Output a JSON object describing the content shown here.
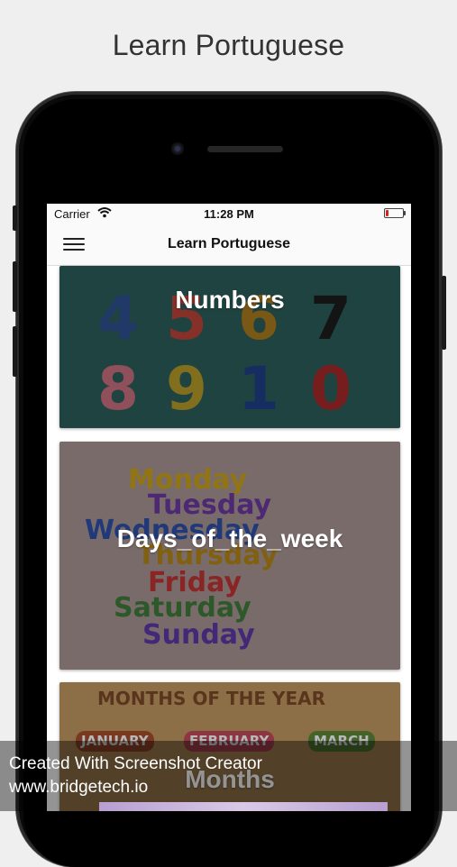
{
  "headline": "Learn Portuguese",
  "status_bar": {
    "carrier": "Carrier",
    "time": "11:28 PM"
  },
  "app_bar": {
    "title": "Learn Portuguese",
    "menu_icon": "hamburger-menu-icon"
  },
  "categories": [
    {
      "label": "Numbers",
      "art_text": [
        "4",
        "5",
        "6",
        "7",
        "8",
        "9",
        "1",
        "0"
      ]
    },
    {
      "label": "Days_of_the_week",
      "art_text": [
        "Monday",
        "Tuesday",
        "Wednesday",
        "Thursday",
        "Friday",
        "Saturday",
        "Sunday"
      ]
    },
    {
      "label": "Months",
      "art_text": [
        "MONTHS OF THE YEAR",
        "JANUARY",
        "FEBRUARY",
        "MARCH"
      ]
    }
  ],
  "footer": {
    "line1": "Created With Screenshot Creator",
    "line2": "www.bridgetech.io"
  },
  "colors": {
    "numbers_bg": "#2c5e5a",
    "days_bg": "#a89594",
    "months_bg": "#c49a63",
    "battery_low": "#e0201a"
  }
}
